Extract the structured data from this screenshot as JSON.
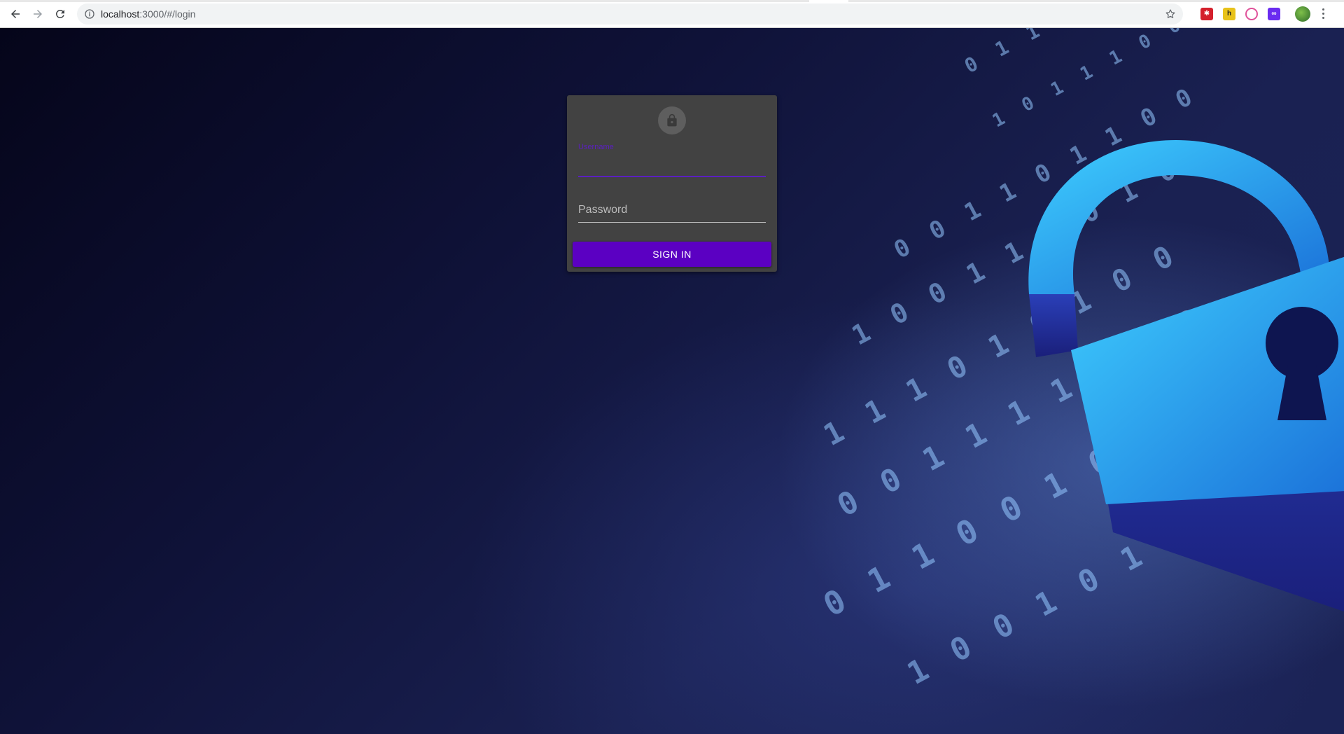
{
  "browser": {
    "url_host": "localhost",
    "url_rest": ":3000/#/login",
    "icons": [
      "back-arrow-icon",
      "forward-arrow-icon",
      "reload-icon",
      "site-info-icon",
      "bookmark-star-icon",
      "more-menu-icon"
    ],
    "extensions": [
      "red-extension-icon",
      "yellow-extension-icon",
      "pink-extension-icon",
      "purple-extension-icon"
    ],
    "extension_labels": {
      "yellow": "h"
    }
  },
  "login": {
    "avatar_icon": "lock-icon",
    "username_label": "Username",
    "username_value": "",
    "password_placeholder": "Password",
    "signin_label": "SIGN IN"
  },
  "colors": {
    "accent": "#5b00c2",
    "card": "#424242",
    "field_focus": "#5b1fc0"
  },
  "background": {
    "binary_rows": [
      "0 1 1 0 1 0 1 1",
      "1 0 1 1 1 0 0 1 0",
      "0 0 1 1 0 1 1 0 0",
      "1 0 0 1 1 1 0 1 0",
      "1 1 1 0 1 0 1 0 0",
      "0 0 1 1 1 1 0 1 0",
      "0 1 1 0 0 1 0 1",
      "1 0 0 1 0 1 1 0"
    ]
  }
}
